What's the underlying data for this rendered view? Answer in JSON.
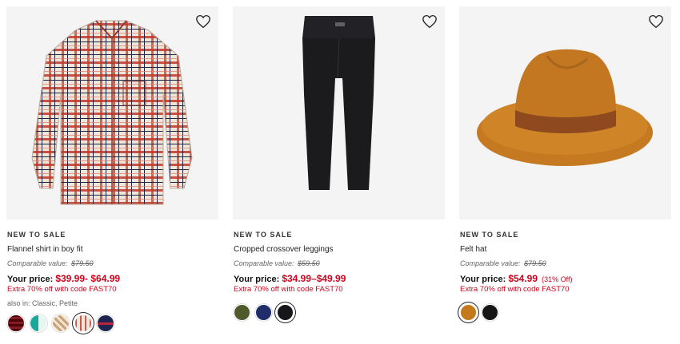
{
  "products": [
    {
      "badge": "NEW TO SALE",
      "name": "Flannel shirt in boy fit",
      "comparable_label": "Comparable value:",
      "comparable_value": "$79.50",
      "price_label": "Your price:",
      "price": "$39.99- $64.99",
      "promo": "Extra 70% off with code FAST70",
      "also_in_label": "also in:",
      "also_in": "Classic, Petite",
      "swatches": [
        {
          "name": "red-black-plaid",
          "color": "#8b1d2c"
        },
        {
          "name": "teal-white-plaid",
          "color": "#1aa89a"
        },
        {
          "name": "tan-plaid",
          "color": "#caa27a"
        },
        {
          "name": "cream-red-plaid",
          "color": "#c9584f"
        },
        {
          "name": "navy-red-plaid",
          "color": "#1f2450"
        }
      ],
      "selected_swatch": 3
    },
    {
      "badge": "NEW TO SALE",
      "name": "Cropped crossover leggings",
      "comparable_label": "Comparable value:",
      "comparable_value": "$59.50",
      "price_label": "Your price:",
      "price": "$34.99–$49.99",
      "promo": "Extra 70% off with code FAST70",
      "swatches": [
        {
          "name": "olive",
          "color": "#4f5a2a"
        },
        {
          "name": "navy",
          "color": "#1f2d6b"
        },
        {
          "name": "black",
          "color": "#17171b"
        }
      ],
      "selected_swatch": 2
    },
    {
      "badge": "NEW TO SALE",
      "name": "Felt hat",
      "comparable_label": "Comparable value:",
      "comparable_value": "$79.50",
      "price_label": "Your price:",
      "price": "$54.99",
      "discount": "(31% Off)",
      "promo": "Extra 70% off with code FAST70",
      "swatches": [
        {
          "name": "camel",
          "color": "#c47a1c"
        },
        {
          "name": "black",
          "color": "#161616"
        }
      ],
      "selected_swatch": 0
    }
  ],
  "icons": {
    "favorite": "heart-outline-icon"
  },
  "colors": {
    "sale_red": "#d0021b",
    "image_bg": "#f4f4f4"
  }
}
